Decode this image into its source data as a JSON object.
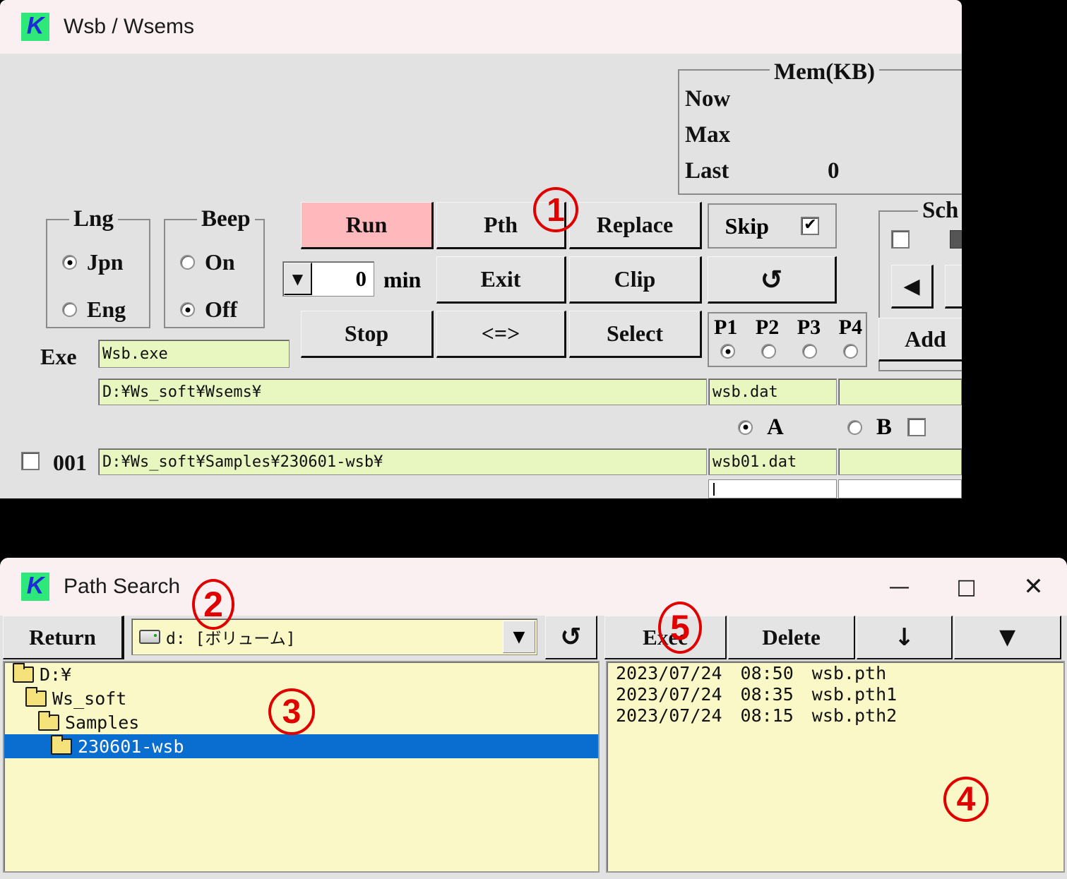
{
  "top_window": {
    "title": "Wsb / Wsems",
    "logo_letter": "K",
    "mem": {
      "group_label": "Mem(KB)",
      "rows": [
        {
          "label": "Now",
          "value": ""
        },
        {
          "label": "Max",
          "value": ""
        },
        {
          "label": "Last",
          "value": "0"
        }
      ]
    },
    "lng": {
      "group_label": "Lng",
      "options": [
        {
          "label": "Jpn",
          "selected": true
        },
        {
          "label": "Eng",
          "selected": false
        }
      ]
    },
    "beep": {
      "group_label": "Beep",
      "options": [
        {
          "label": "On",
          "selected": false
        },
        {
          "label": "Off",
          "selected": true
        }
      ]
    },
    "buttons": {
      "run": "Run",
      "pth": "Pth",
      "replace": "Replace",
      "exit": "Exit",
      "clip": "Clip",
      "stop": "Stop",
      "swap": "<=>",
      "select": "Select",
      "refresh_icon": "↺",
      "add": "Add"
    },
    "timer": {
      "value": "0",
      "unit": "min",
      "dropdown_icon": "▼"
    },
    "skip": {
      "label": "Skip",
      "checked": true
    },
    "presets": {
      "labels": [
        "P1",
        "P2",
        "P3",
        "P4"
      ],
      "selected_index": 0
    },
    "schedule": {
      "group_label": "Sch",
      "checked": false,
      "prev_icon": "◀"
    },
    "exe": {
      "label": "Exe",
      "value": "Wsb.exe"
    },
    "row_header": {
      "path": "D:¥Ws_soft¥Wsems¥",
      "dat": "wsb.dat",
      "extra": ""
    },
    "ab": {
      "options": [
        {
          "label": "A",
          "selected": true
        },
        {
          "label": "B",
          "selected": false
        }
      ],
      "checkbox_checked": false
    },
    "row_001": {
      "checked": false,
      "number": "001",
      "path": "D:¥Ws_soft¥Samples¥230601-wsb¥",
      "dat": "wsb01.dat",
      "extra": ""
    },
    "colors": {
      "run_button": "#ffb8bc",
      "field_green": "#e8f7c0",
      "titlebar": "#faf0f2"
    }
  },
  "bottom_window": {
    "title": "Path Search",
    "logo_letter": "K",
    "window_controls": {
      "minimize": "—",
      "maximize": "□",
      "close": "✕"
    },
    "toolbar": {
      "return": "Return",
      "refresh_icon": "↺",
      "exec": "Exec",
      "delete": "Delete",
      "download_icon": "↓",
      "expand_icon": "▼"
    },
    "drive_select": {
      "value": "d: [ボリューム]",
      "arrow_icon": "▼",
      "icon": "drive-icon"
    },
    "tree": [
      {
        "label": "D:¥",
        "indent": 0,
        "selected": false
      },
      {
        "label": "Ws_soft",
        "indent": 1,
        "selected": false
      },
      {
        "label": "Samples",
        "indent": 2,
        "selected": false
      },
      {
        "label": "230601-wsb",
        "indent": 3,
        "selected": true
      }
    ],
    "files": [
      {
        "date": "2023/07/24",
        "time": "08:50",
        "name": "wsb.pth"
      },
      {
        "date": "2023/07/24",
        "time": "08:35",
        "name": "wsb.pth1"
      },
      {
        "date": "2023/07/24",
        "time": "08:15",
        "name": "wsb.pth2"
      }
    ],
    "colors": {
      "pane_bg": "#fbf8c8",
      "selection": "#0a6ed1"
    }
  },
  "annotations": [
    {
      "id": "1",
      "label": "1"
    },
    {
      "id": "2",
      "label": "2"
    },
    {
      "id": "3",
      "label": "3"
    },
    {
      "id": "4",
      "label": "4"
    },
    {
      "id": "5",
      "label": "5"
    }
  ]
}
